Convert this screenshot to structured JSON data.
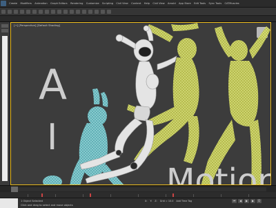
{
  "menubar": {
    "items": [
      "Create",
      "Modifiers",
      "Animation",
      "Graph Editors",
      "Rendering",
      "Customize",
      "Scripting",
      "Civil View",
      "Content",
      "Help",
      "Civil View",
      "Arnold",
      "App Store",
      "Edit Tools",
      "Sync Tools",
      "CATMuscles"
    ]
  },
  "viewport": {
    "label": "[+] [Perspective] [Default Shading]"
  },
  "overlay": {
    "line1": "A",
    "line2": "I",
    "line3": "Motion"
  },
  "status": {
    "line1": "1 Object Selected",
    "line2": "Click and drag to select and move objects",
    "x_label": "X:",
    "y_label": "Y:",
    "z_label": "Z:",
    "grid": "Grid = 10.0",
    "add_time_tag": "Add Time Tag",
    "frame": "0"
  },
  "colors": {
    "viewport_border": "#f0c020",
    "wire_yellow": "#c8cf5a",
    "wire_cyan": "#6cc3c9",
    "robot": "#e6e6e6"
  }
}
